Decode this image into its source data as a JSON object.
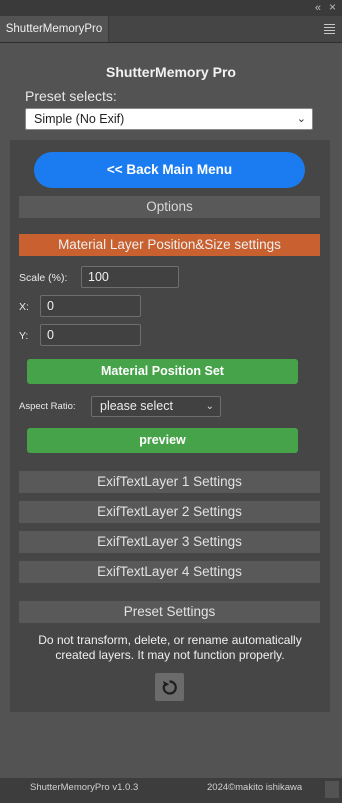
{
  "window": {
    "tab_label": "ShutterMemoryPro",
    "collapse_glyph": "«",
    "close_glyph": "×"
  },
  "header": {
    "title": "ShutterMemory Pro",
    "preset_label": "Preset selects:",
    "preset_value": "Simple (No Exif)"
  },
  "main": {
    "back_button": "<< Back Main Menu",
    "options_label": "Options",
    "material_section": "Material Layer Position&Size settings",
    "scale_label": "Scale (%):",
    "scale_value": "100",
    "x_label": "X:",
    "x_value": "0",
    "y_label": "Y:",
    "y_value": "0",
    "material_position_button": "Material Position Set",
    "aspect_label": "Aspect Ratio:",
    "aspect_value": "please select",
    "preview_button": "preview",
    "exif_sections": [
      "ExifTextLayer 1 Settings",
      "ExifTextLayer 2 Settings",
      "ExifTextLayer 3 Settings",
      "ExifTextLayer 4 Settings"
    ],
    "preset_settings": "Preset Settings",
    "warning_line1": "Do not transform, delete, or rename automatically",
    "warning_line2": "created layers. It may not function properly."
  },
  "footer": {
    "version": "ShutterMemoryPro v1.0.3",
    "copyright": "2024©makito ishikawa"
  },
  "colors": {
    "accent_blue": "#1a7cf0",
    "section_orange": "#c8602f",
    "button_green": "#47a34a",
    "background": "#535353"
  },
  "icons": {
    "reset": "reset-icon",
    "menu": "menu-icon",
    "dropdown": "chevron-down-icon"
  }
}
